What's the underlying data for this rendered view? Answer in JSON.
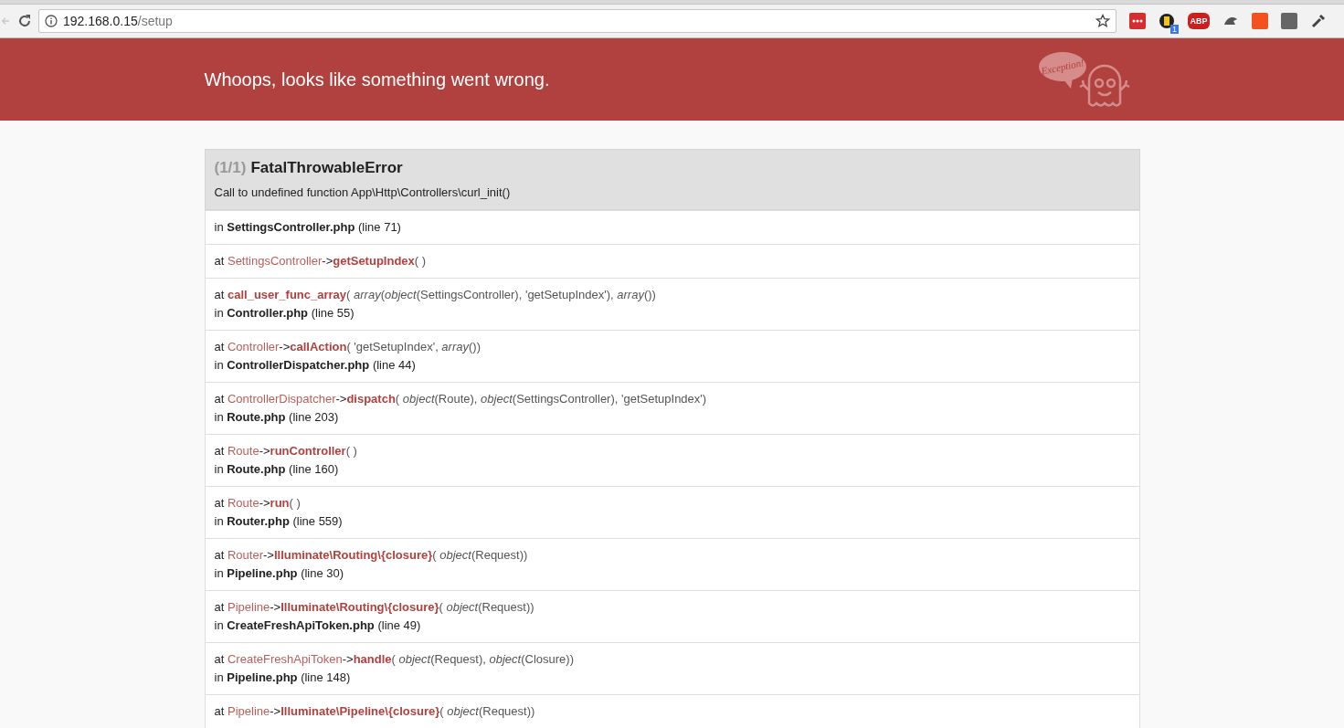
{
  "browser": {
    "url_host": "192.168.0.15",
    "url_path": "/setup",
    "back_disabled": true,
    "extensions": [
      {
        "kind": "dots",
        "color": "#d32f2f"
      },
      {
        "kind": "badge",
        "color": "#222222",
        "badge": "1"
      },
      {
        "kind": "label",
        "color": "#cc1f1f",
        "label": "ABP"
      },
      {
        "kind": "hat",
        "color": "#555555"
      },
      {
        "kind": "square",
        "color": "#f4511e"
      },
      {
        "kind": "square",
        "color": "#666666"
      },
      {
        "kind": "dropper",
        "color": "#444444"
      }
    ]
  },
  "header": {
    "title": "Whoops, looks like something went wrong.",
    "logo_bubble": "Exception!"
  },
  "exception": {
    "count": "(1/1)",
    "name": "FatalThrowableError",
    "message": "Call to undefined function App\\Http\\Controllers\\curl_init()",
    "frames": [
      {
        "location": {
          "prefix": "in",
          "file": "SettingsController.php",
          "line": "(line 71)"
        }
      },
      {
        "call": {
          "prefix": "at",
          "class": "SettingsController",
          "arrow": "->",
          "function": "getSetupIndex",
          "args": "( )"
        }
      },
      {
        "call": {
          "prefix": "at",
          "function": "call_user_func_array",
          "args": "( *array*(*object*(SettingsController), 'getSetupIndex'), *array*())"
        },
        "location": {
          "prefix": "in",
          "file": "Controller.php",
          "line": "(line 55)"
        }
      },
      {
        "call": {
          "prefix": "at",
          "class": "Controller",
          "arrow": "->",
          "function": "callAction",
          "args": "( 'getSetupIndex', *array*())"
        },
        "location": {
          "prefix": "in",
          "file": "ControllerDispatcher.php",
          "line": "(line 44)"
        }
      },
      {
        "call": {
          "prefix": "at",
          "class": "ControllerDispatcher",
          "arrow": "->",
          "function": "dispatch",
          "args": "( *object*(Route), *object*(SettingsController), 'getSetupIndex')"
        },
        "location": {
          "prefix": "in",
          "file": "Route.php",
          "line": "(line 203)"
        }
      },
      {
        "call": {
          "prefix": "at",
          "class": "Route",
          "arrow": "->",
          "function": "runController",
          "args": "( )"
        },
        "location": {
          "prefix": "in",
          "file": "Route.php",
          "line": "(line 160)"
        }
      },
      {
        "call": {
          "prefix": "at",
          "class": "Route",
          "arrow": "->",
          "function": "run",
          "args": "( )"
        },
        "location": {
          "prefix": "in",
          "file": "Router.php",
          "line": "(line 559)"
        }
      },
      {
        "call": {
          "prefix": "at",
          "class": "Router",
          "arrow": "->",
          "function": "Illuminate\\Routing\\{closure}",
          "args": "( *object*(Request))"
        },
        "location": {
          "prefix": "in",
          "file": "Pipeline.php",
          "line": "(line 30)"
        }
      },
      {
        "call": {
          "prefix": "at",
          "class": "Pipeline",
          "arrow": "->",
          "function": "Illuminate\\Routing\\{closure}",
          "args": "( *object*(Request))"
        },
        "location": {
          "prefix": "in",
          "file": "CreateFreshApiToken.php",
          "line": "(line 49)"
        }
      },
      {
        "call": {
          "prefix": "at",
          "class": "CreateFreshApiToken",
          "arrow": "->",
          "function": "handle",
          "args": "( *object*(Request), *object*(Closure))"
        },
        "location": {
          "prefix": "in",
          "file": "Pipeline.php",
          "line": "(line 148)"
        }
      },
      {
        "call": {
          "prefix": "at",
          "class": "Pipeline",
          "arrow": "->",
          "function": "Illuminate\\Pipeline\\{closure}",
          "args": "( *object*(Request))"
        }
      }
    ]
  }
}
